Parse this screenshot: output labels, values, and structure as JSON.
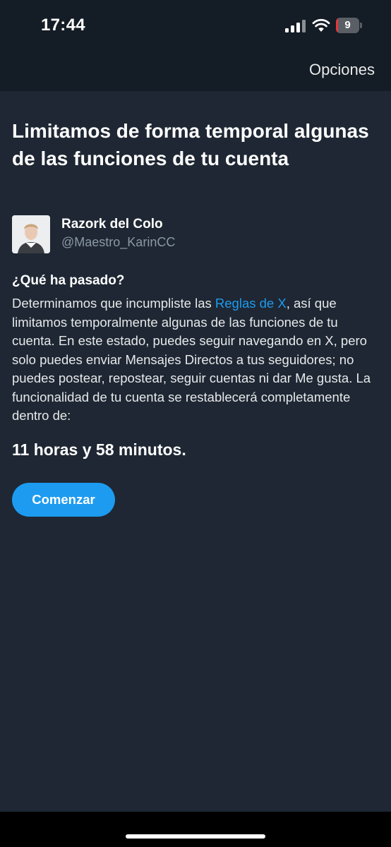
{
  "status_bar": {
    "time": "17:44",
    "battery_level": "9",
    "battery_fraction": 0.09,
    "battery_color": "#e5363c"
  },
  "header": {
    "options_label": "Opciones"
  },
  "main": {
    "title": "Limitamos de forma temporal algunas de las funciones de tu cuenta",
    "user": {
      "name": "Razork del Colo",
      "handle": "@Maestro_KarinCC"
    },
    "question": "¿Qué ha pasado?",
    "body_before_link": "Determinamos que incumpliste las ",
    "body_link": "Reglas de X",
    "body_after_link": ", así que limitamos temporalmente algunas de las funciones de tu cuenta. En este estado, puedes seguir navegando en X, pero solo puedes enviar Mensajes Directos a tus seguidores; no puedes postear, repostear, seguir cuentas ni dar Me gusta. La funcionalidad de tu cuenta se restablecerá completamente dentro de:",
    "remaining_time": "11 horas y 58 minutos.",
    "cta_label": "Comenzar"
  },
  "colors": {
    "background": "#1e2733",
    "header_background": "#141c25",
    "accent": "#1d9bf0",
    "secondary_text": "#8b98a5"
  },
  "icons": [
    "signal-icon",
    "wifi-icon",
    "battery-icon"
  ]
}
